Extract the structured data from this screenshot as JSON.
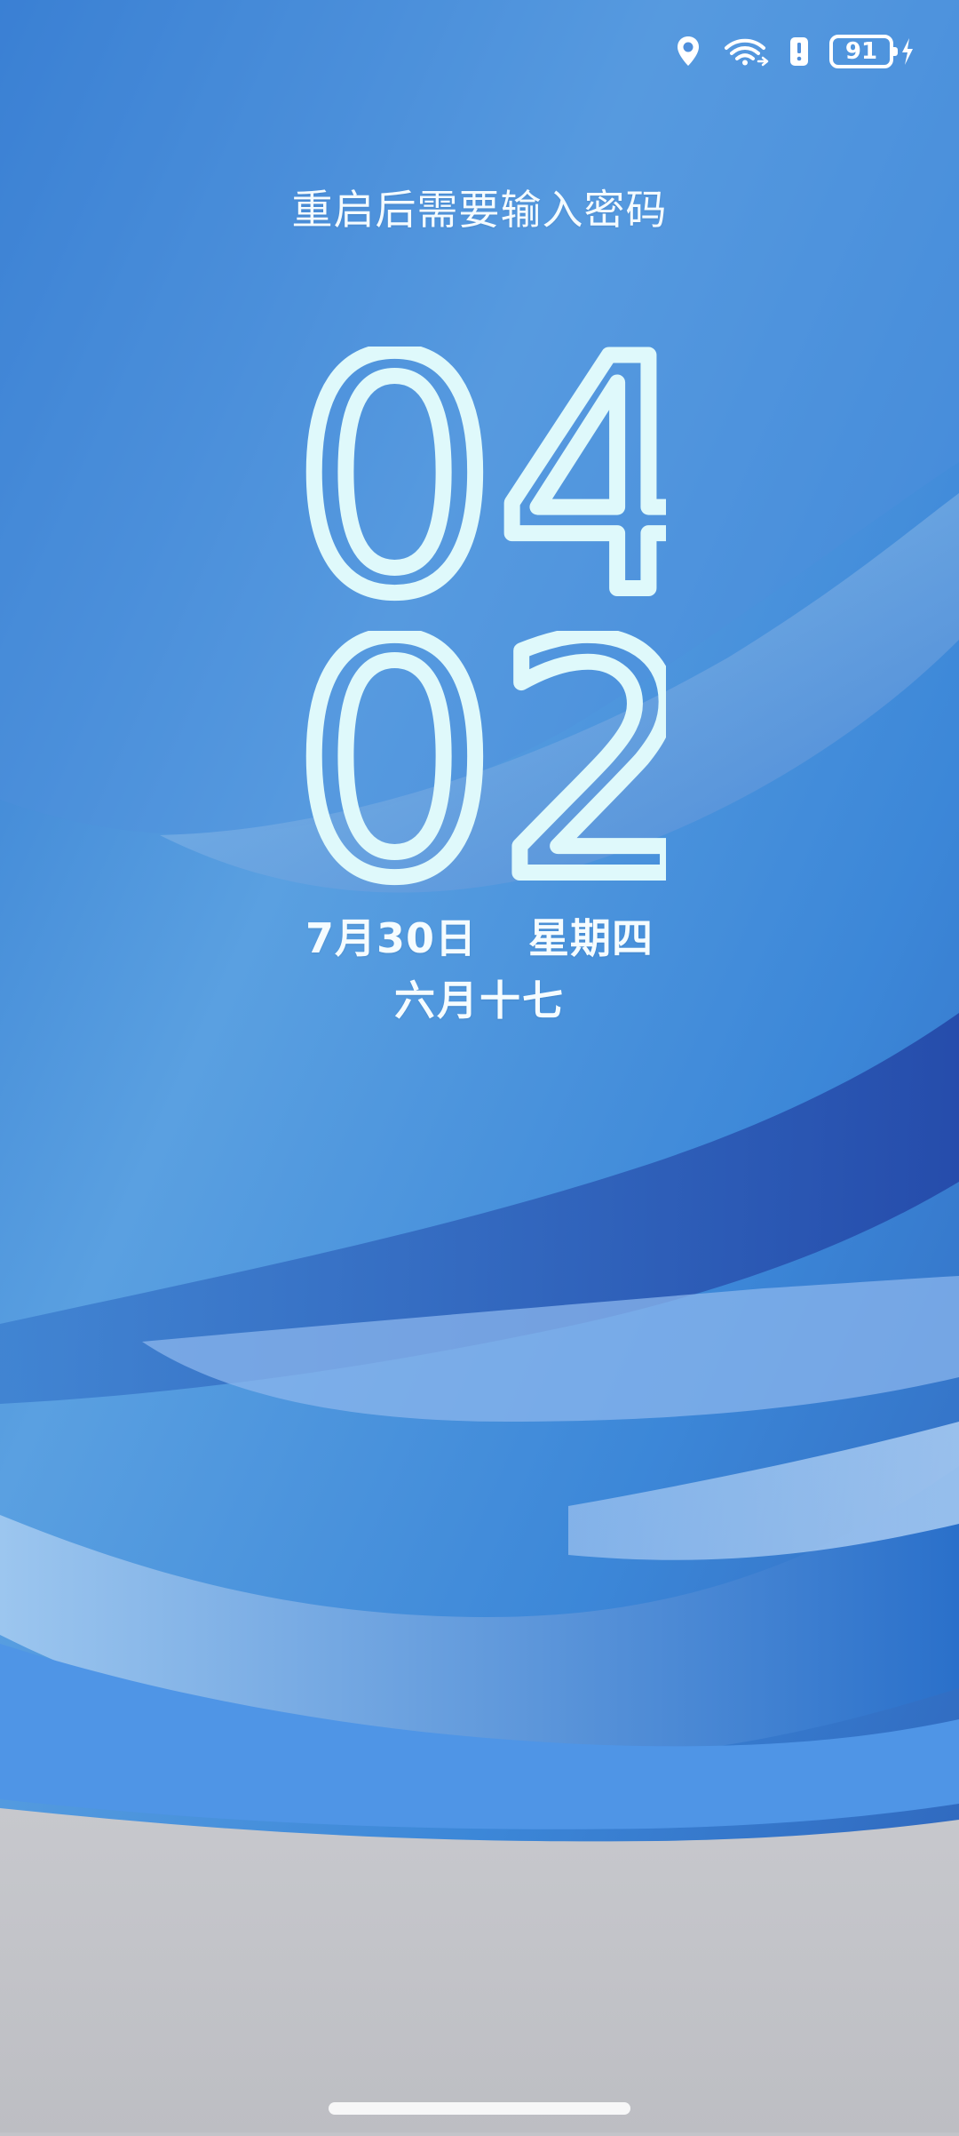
{
  "status_bar": {
    "icons": [
      "location-icon",
      "wifi-icon",
      "alert-icon",
      "charging-icon"
    ],
    "battery_level": "91"
  },
  "lockscreen": {
    "hint": "重启后需要输入密码",
    "time": {
      "hours": "04",
      "minutes": "02"
    },
    "date": {
      "day": "7月30日",
      "weekday": "星期四"
    },
    "lunar_date": "六月十七"
  },
  "colors": {
    "clock": "#dff9fb",
    "text": "#f5fcff",
    "background_blue": "#3f87d8",
    "background_gray": "#c3c4c9"
  }
}
